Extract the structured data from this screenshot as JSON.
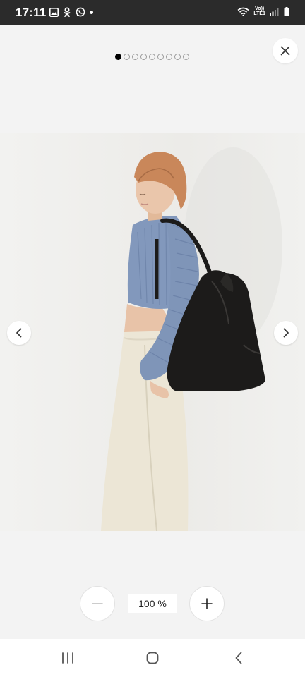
{
  "status_bar": {
    "time": "17:11",
    "left_icons": [
      "gallery-icon",
      "ok-icon",
      "whatsapp-icon",
      "notification-dot"
    ],
    "network_label_top": "Vo))",
    "network_label_bottom": "LTE1",
    "right_icons": [
      "wifi-icon",
      "signal-icon",
      "battery-icon"
    ]
  },
  "viewer": {
    "page_count": 9,
    "current_page": 1,
    "zoom_label": "100 %",
    "close_icon": "close-icon",
    "prev_icon": "chevron-left-icon",
    "next_icon": "chevron-right-icon",
    "zoom_out_icon": "minus-icon",
    "zoom_in_icon": "plus-icon"
  },
  "nav_bar": {
    "recents_icon": "recents-icon",
    "home_icon": "home-icon",
    "back_icon": "back-icon"
  },
  "colors": {
    "status_bar": "#2b2b2b",
    "background": "#f3f3f3",
    "sweater": "#7f95b8",
    "pants": "#ece6d6",
    "bag": "#1c1b1a",
    "hair": "#c9875a"
  }
}
